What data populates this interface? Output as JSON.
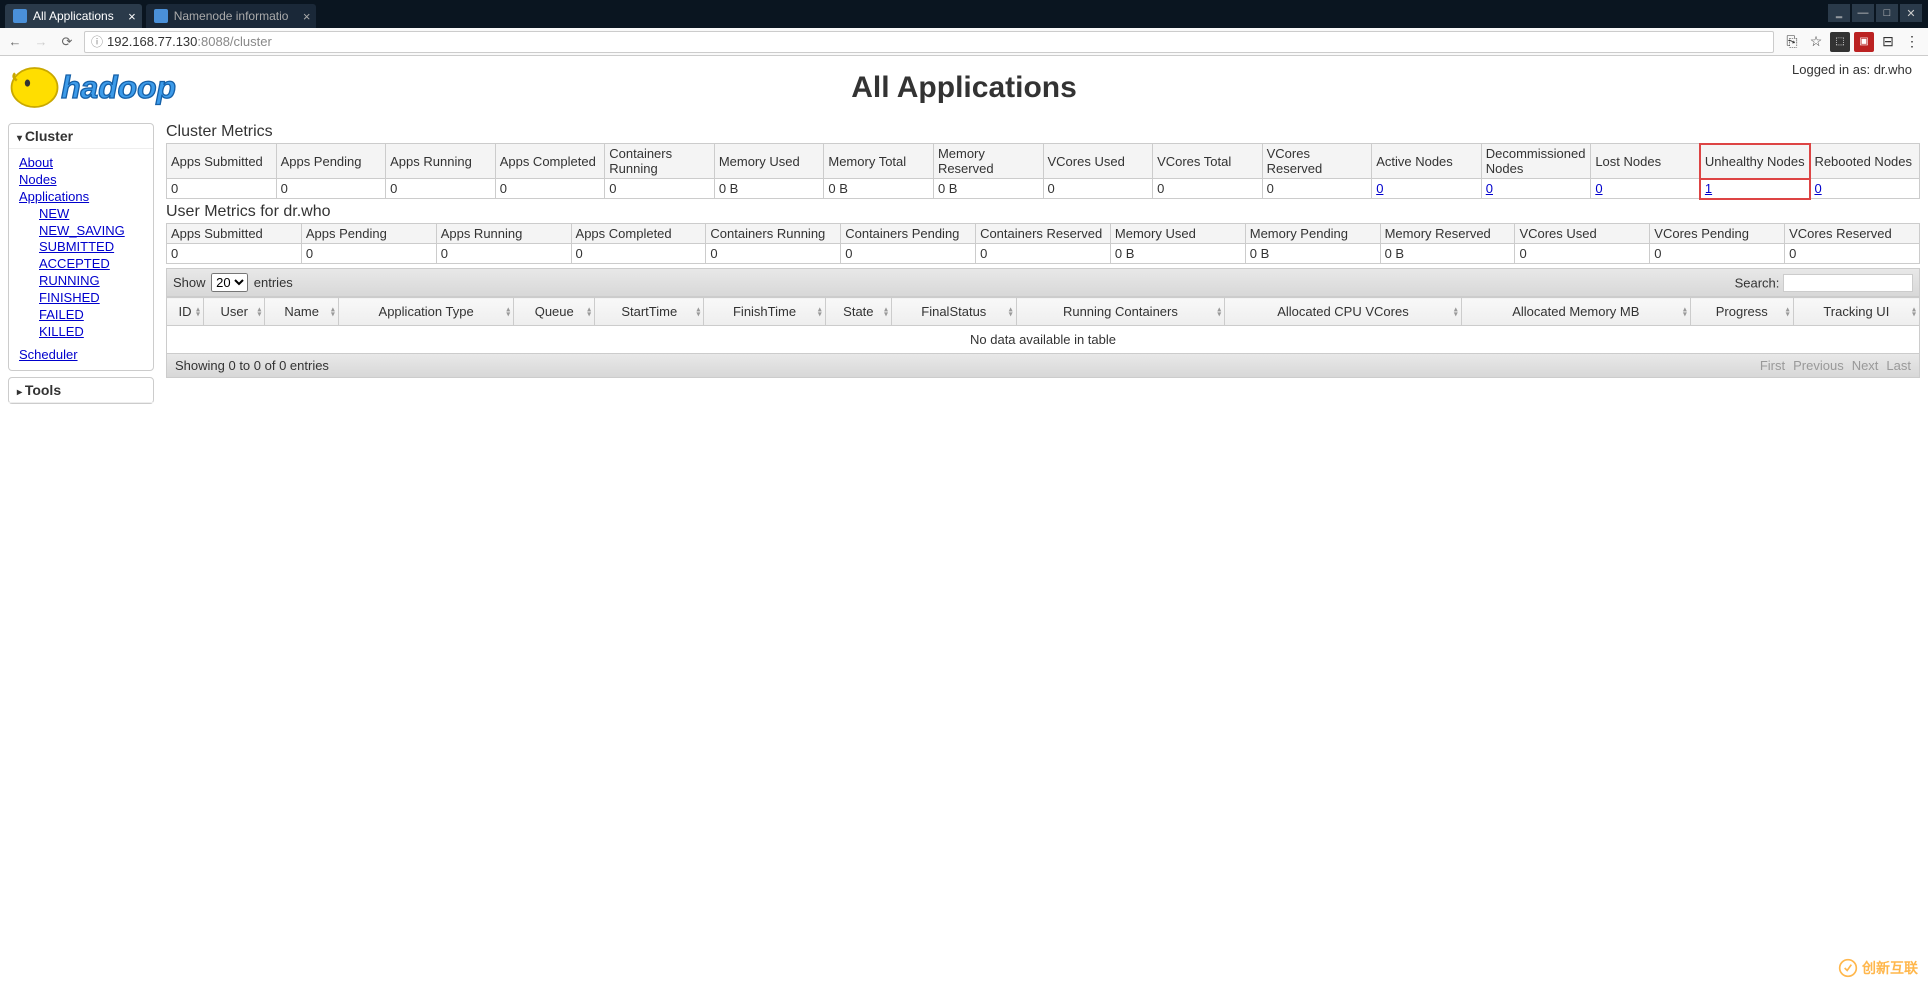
{
  "browser": {
    "tabs": [
      {
        "title": "All Applications",
        "active": true
      },
      {
        "title": "Namenode informatio",
        "active": false
      }
    ],
    "url_display_prefix": "192.168.77.130",
    "url_display_suffix": ":8088/cluster"
  },
  "page": {
    "title": "All Applications",
    "login_status": "Logged in as: dr.who"
  },
  "sidebar": {
    "cluster_label": "Cluster",
    "tools_label": "Tools",
    "about": "About",
    "nodes": "Nodes",
    "applications": "Applications",
    "scheduler": "Scheduler",
    "app_states": [
      "NEW",
      "NEW_SAVING",
      "SUBMITTED",
      "ACCEPTED",
      "RUNNING",
      "FINISHED",
      "FAILED",
      "KILLED"
    ]
  },
  "cluster_metrics": {
    "title": "Cluster Metrics",
    "headers": [
      "Apps Submitted",
      "Apps Pending",
      "Apps Running",
      "Apps Completed",
      "Containers Running",
      "Memory Used",
      "Memory Total",
      "Memory Reserved",
      "VCores Used",
      "VCores Total",
      "VCores Reserved",
      "Active Nodes",
      "Decommissioned Nodes",
      "Lost Nodes",
      "Unhealthy Nodes",
      "Rebooted Nodes"
    ],
    "values": [
      "0",
      "0",
      "0",
      "0",
      "0",
      "0 B",
      "0 B",
      "0 B",
      "0",
      "0",
      "0",
      "0",
      "0",
      "0",
      "1",
      "0"
    ],
    "link_flags": [
      false,
      false,
      false,
      false,
      false,
      false,
      false,
      false,
      false,
      false,
      false,
      true,
      true,
      true,
      true,
      true
    ],
    "highlight_index": 14
  },
  "user_metrics": {
    "title": "User Metrics for dr.who",
    "headers": [
      "Apps Submitted",
      "Apps Pending",
      "Apps Running",
      "Apps Completed",
      "Containers Running",
      "Containers Pending",
      "Containers Reserved",
      "Memory Used",
      "Memory Pending",
      "Memory Reserved",
      "VCores Used",
      "VCores Pending",
      "VCores Reserved"
    ],
    "values": [
      "0",
      "0",
      "0",
      "0",
      "0",
      "0",
      "0",
      "0 B",
      "0 B",
      "0 B",
      "0",
      "0",
      "0"
    ]
  },
  "apps_table": {
    "show_label": "Show",
    "show_value": "20",
    "entries_label": "entries",
    "search_label": "Search:",
    "columns": [
      "ID",
      "User",
      "Name",
      "Application Type",
      "Queue",
      "StartTime",
      "FinishTime",
      "State",
      "FinalStatus",
      "Running Containers",
      "Allocated CPU VCores",
      "Allocated Memory MB",
      "Progress",
      "Tracking UI"
    ],
    "empty_msg": "No data available in table",
    "info_text": "Showing 0 to 0 of 0 entries",
    "pagination": [
      "First",
      "Previous",
      "Next",
      "Last"
    ]
  },
  "watermark": "创新互联"
}
